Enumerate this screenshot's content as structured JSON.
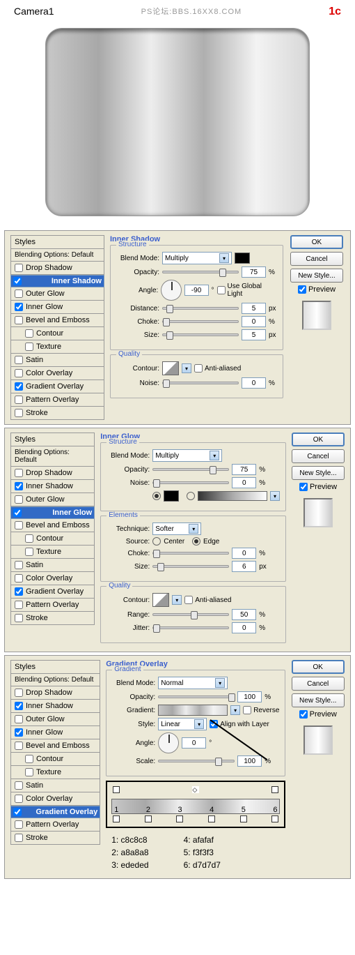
{
  "header": {
    "title": "Camera1",
    "watermark": "PS论坛:BBS.16XX8.COM",
    "label": "1c"
  },
  "styles_panel": {
    "header": "Styles",
    "subheader": "Blending Options: Default",
    "items": [
      "Drop Shadow",
      "Inner Shadow",
      "Outer Glow",
      "Inner Glow",
      "Bevel and Emboss",
      "Contour",
      "Texture",
      "Satin",
      "Color Overlay",
      "Gradient Overlay",
      "Pattern Overlay",
      "Stroke"
    ]
  },
  "buttons": {
    "ok": "OK",
    "cancel": "Cancel",
    "newstyle": "New Style...",
    "preview": "Preview"
  },
  "units": {
    "pct": "%",
    "px": "px",
    "deg": "°"
  },
  "labels": {
    "blend_mode": "Blend Mode:",
    "opacity": "Opacity:",
    "angle": "Angle:",
    "distance": "Distance:",
    "choke": "Choke:",
    "size": "Size:",
    "contour": "Contour:",
    "noise": "Noise:",
    "anti": "Anti-aliased",
    "global": "Use Global Light",
    "technique": "Technique:",
    "source": "Source:",
    "center": "Center",
    "edge": "Edge",
    "range": "Range:",
    "jitter": "Jitter:",
    "gradient": "Gradient:",
    "reverse": "Reverse",
    "align": "Align with Layer",
    "style": "Style:",
    "scale": "Scale:"
  },
  "panel1": {
    "title": "Inner Shadow",
    "g1": "Structure",
    "g2": "Quality",
    "blend": "Multiply",
    "opacity": "75",
    "angle": "-90",
    "distance": "5",
    "choke": "0",
    "size": "5",
    "noise": "0",
    "checked": [
      "Inner Shadow",
      "Inner Glow",
      "Gradient Overlay"
    ],
    "selected": "Inner Shadow"
  },
  "panel2": {
    "title": "Inner Glow",
    "g1": "Structure",
    "g2": "Elements",
    "g3": "Quality",
    "blend": "Multiply",
    "opacity": "75",
    "noise": "0",
    "technique": "Softer",
    "choke": "0",
    "size": "6",
    "range": "50",
    "jitter": "0",
    "checked": [
      "Inner Shadow",
      "Inner Glow",
      "Gradient Overlay"
    ],
    "selected": "Inner Glow"
  },
  "panel3": {
    "title": "Gradient Overlay",
    "g1": "Gradient",
    "blend": "Normal",
    "opacity": "100",
    "style": "Linear",
    "angle": "0",
    "scale": "100",
    "checked": [
      "Inner Shadow",
      "Inner Glow",
      "Gradient Overlay"
    ],
    "selected": "Gradient Overlay",
    "stops": [
      "1",
      "2",
      "3",
      "4",
      "5",
      "6"
    ],
    "legend_left": [
      "1: c8c8c8",
      "2: a8a8a8",
      "3: ededed"
    ],
    "legend_right": [
      "4: afafaf",
      "5: f3f3f3",
      "6: d7d7d7"
    ]
  },
  "chart_data": {
    "type": "table",
    "title": "Gradient Stops",
    "categories": [
      "1",
      "2",
      "3",
      "4",
      "5",
      "6"
    ],
    "values": [
      "c8c8c8",
      "a8a8a8",
      "ededed",
      "afafaf",
      "f3f3f3",
      "d7d7d7"
    ]
  }
}
